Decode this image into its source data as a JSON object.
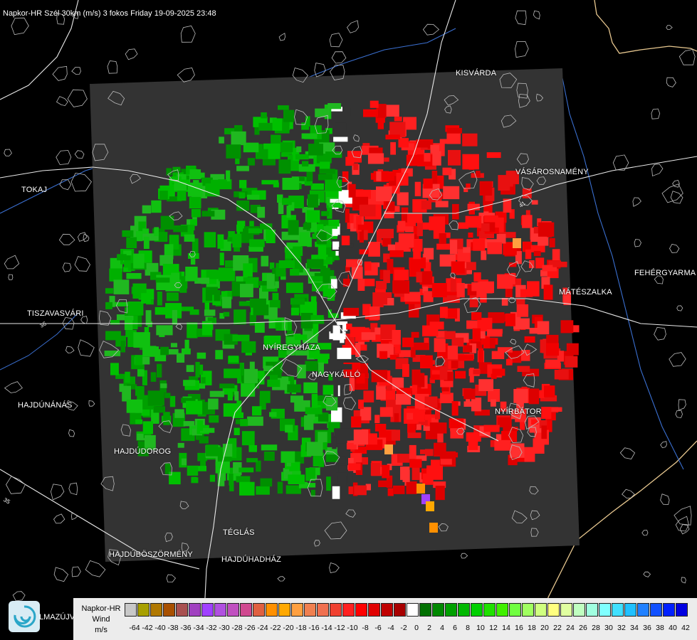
{
  "header": {
    "title": "Napkor-HR Szél 30km (m/s) 3 fokos Friday 19-09-2025 23:48"
  },
  "cities": [
    {
      "id": "kisvarda",
      "label": "KISVÁRDA"
    },
    {
      "id": "tokaj",
      "label": "TOKAJ"
    },
    {
      "id": "vasarosnameny",
      "label": "VÁSÁROSNAMÉNY"
    },
    {
      "id": "fehergyarmat",
      "label": "FEHÉRGYARMA"
    },
    {
      "id": "tiszavasvari",
      "label": "TISZAVASVÁRI"
    },
    {
      "id": "mateszalka",
      "label": "MÁTÉSZALKA"
    },
    {
      "id": "nyiregyhaza",
      "label": "NYÍREGYHÁZA"
    },
    {
      "id": "nagykallo",
      "label": "NAGYKÁLLÓ"
    },
    {
      "id": "hajdunanas",
      "label": "HAJDÚNÁNÁS"
    },
    {
      "id": "nyirbator",
      "label": "NYÍRBÁTOR"
    },
    {
      "id": "hajdudorog",
      "label": "HAJDÚDOROG"
    },
    {
      "id": "teglas",
      "label": "TÉGLÁS"
    },
    {
      "id": "hajduboszormeny",
      "label": "HAJDÚBÖSZÖRMÉNY"
    },
    {
      "id": "hajduhadhaz",
      "label": "HAJDÚHADHÁZ"
    }
  ],
  "road_numbers": [
    "41",
    "36",
    "35"
  ],
  "logo": {
    "partial_label": "LMAZÚJVÁR"
  },
  "legend": {
    "line1": "Napkor-HR",
    "line2": "Wind",
    "unit": "m/s",
    "ticks": [
      "-64",
      "-42",
      "-40",
      "-38",
      "-36",
      "-34",
      "-32",
      "-30",
      "-28",
      "-26",
      "-24",
      "-22",
      "-20",
      "-18",
      "-16",
      "-14",
      "-12",
      "-10",
      "-8",
      "-6",
      "-4",
      "-2",
      "0",
      "2",
      "4",
      "6",
      "8",
      "10",
      "12",
      "14",
      "16",
      "18",
      "20",
      "22",
      "24",
      "26",
      "28",
      "30",
      "32",
      "34",
      "36",
      "38",
      "40",
      "42"
    ],
    "colors": [
      "#c8c8c8",
      "#a8a000",
      "#b07800",
      "#a85000",
      "#a85050",
      "#a040c0",
      "#a040ff",
      "#b050e0",
      "#c050c0",
      "#d04890",
      "#e06040",
      "#ff9000",
      "#ffa800",
      "#ffa040",
      "#f08050",
      "#f07050",
      "#f04030",
      "#ff2020",
      "#ff0000",
      "#e00000",
      "#c00000",
      "#a80000",
      "#ffffff",
      "#007000",
      "#008800",
      "#00a000",
      "#00b800",
      "#00d000",
      "#20e000",
      "#40f000",
      "#70ff40",
      "#a0ff60",
      "#d0ff80",
      "#ffff80",
      "#e0ffa0",
      "#c0ffc0",
      "#a0ffe0",
      "#80ffff",
      "#40e0ff",
      "#20c0ff",
      "#2080ff",
      "#1050ff",
      "#0020ff",
      "#0000e0"
    ]
  },
  "colors": {
    "background": "#000000",
    "radar_frame": "#333333",
    "approach": "#00a000",
    "recede": "#ff1010"
  }
}
